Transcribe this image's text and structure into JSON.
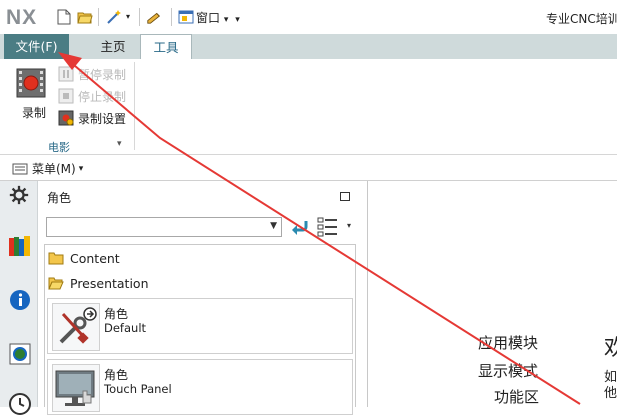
{
  "titlebar": {
    "logo": "NX",
    "window_menu": "窗口",
    "window_menu_arrow": "▾",
    "app_title": "专业CNC培训"
  },
  "tabs": [
    {
      "label": "文件(F)"
    },
    {
      "label": "主页"
    },
    {
      "label": "工具"
    }
  ],
  "ribbon": {
    "record_label": "录制",
    "items": [
      {
        "label": "暂停录制",
        "enabled": false
      },
      {
        "label": "停止录制",
        "enabled": false
      },
      {
        "label": "录制设置",
        "enabled": true
      }
    ],
    "group_label": "电影",
    "group_expand": "▾"
  },
  "menubar": {
    "menu_label": "菜单(M)",
    "menu_arrow": "▾"
  },
  "navigator": {
    "title": "角色",
    "select_value": "",
    "select_arrow": "▼",
    "view_arrow": "▾",
    "folders": [
      {
        "label": "Content"
      },
      {
        "label": "Presentation"
      }
    ],
    "roles": [
      {
        "name": "角色",
        "desc": "Default"
      },
      {
        "name": "角色",
        "desc": "Touch Panel"
      }
    ]
  },
  "welcome": {
    "line1": "应用模块",
    "line2": "显示模式",
    "line3": "功能区",
    "heading_fragment": "欢",
    "side_text_1": "如",
    "side_text_2": "他"
  },
  "colors": {
    "file_tab_bg": "#4b7d84",
    "tabbar_bg": "#cfdadb",
    "accent_text": "#2a6a88",
    "arrow_red": "#e53935"
  }
}
